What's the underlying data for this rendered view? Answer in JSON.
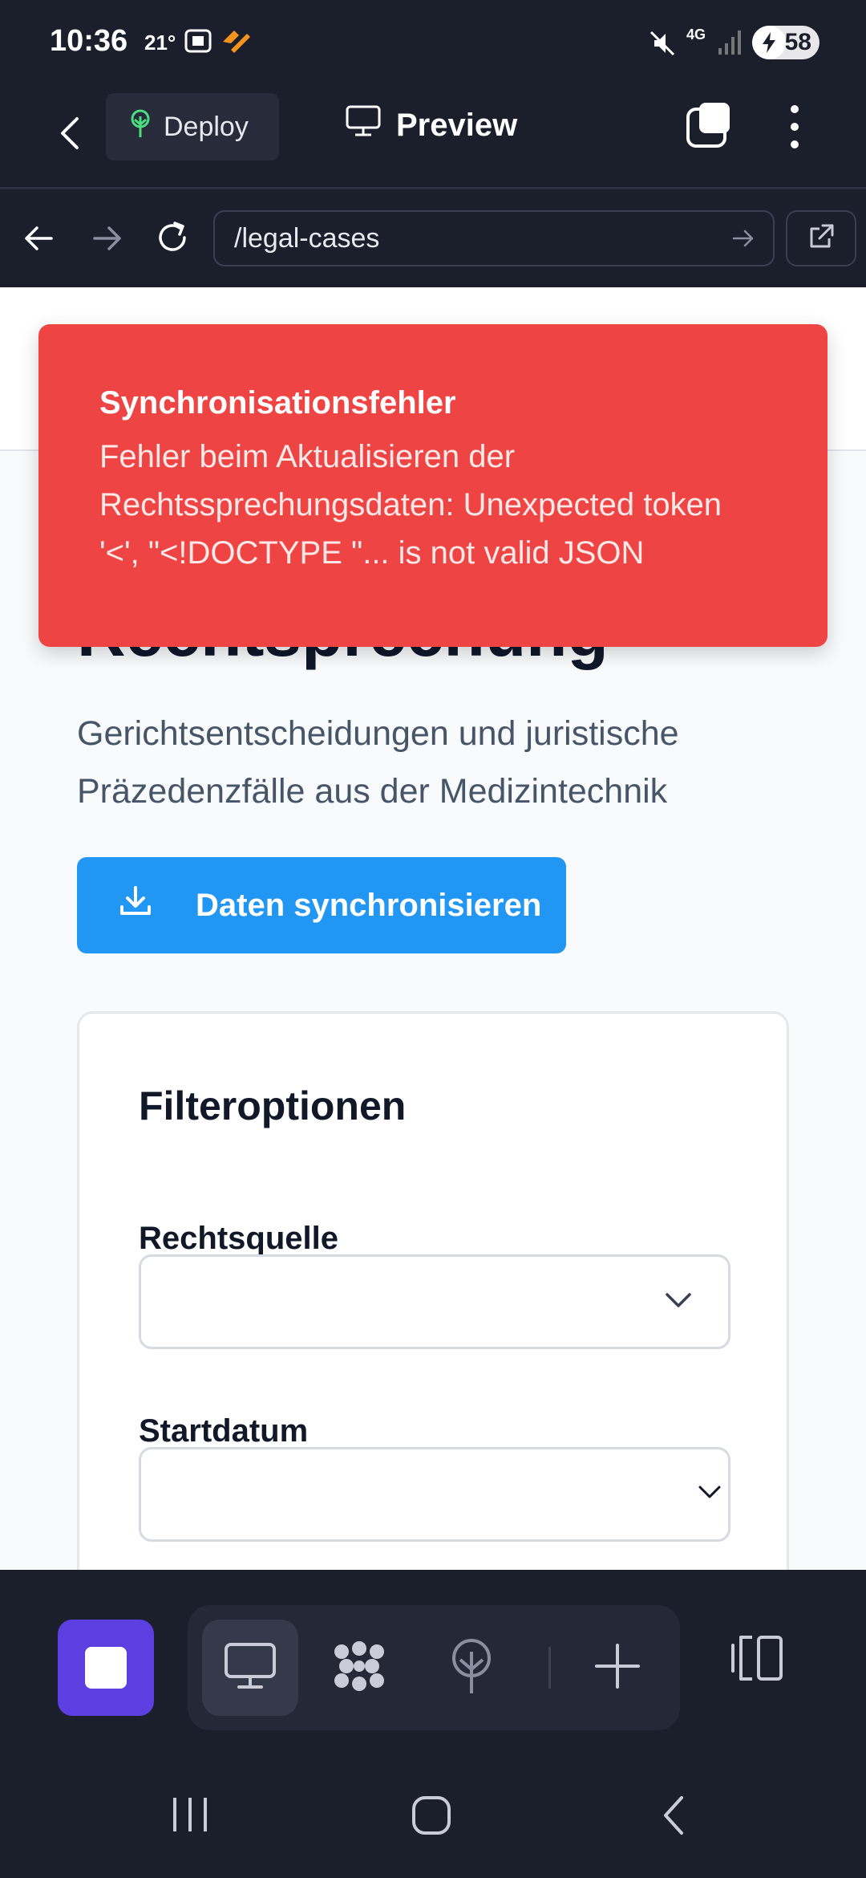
{
  "status_bar": {
    "time": "10:36",
    "temperature": "21°",
    "battery": "58",
    "network": "4G"
  },
  "app_bar": {
    "deploy_label": "Deploy",
    "preview_label": "Preview"
  },
  "browser": {
    "url": "/legal-cases"
  },
  "page": {
    "title": "Rechtsprechung",
    "subtitle": "Gerichtsentscheidungen und juristische Präzedenzfälle aus der Medizintechnik",
    "sync_button_label": "Daten synchronisieren",
    "filter": {
      "title": "Filteroptionen",
      "source_label": "Rechtsquelle",
      "source_value": "",
      "start_date_label": "Startdatum",
      "start_date_value": ""
    }
  },
  "toast": {
    "title": "Synchronisationsfehler",
    "message": "Fehler beim Aktualisieren der Rechtssprechungsdaten: Unexpected token '<', \"<!DOCTYPE \"... is not valid JSON"
  },
  "colors": {
    "toast_bg": "#ef4444",
    "primary_button": "#2196f3",
    "stop_button": "#5b3fe0",
    "chrome_bg": "#1b1e2b"
  },
  "icons": {
    "deploy": "tree-icon",
    "preview": "monitor-icon",
    "sync": "download-icon"
  }
}
